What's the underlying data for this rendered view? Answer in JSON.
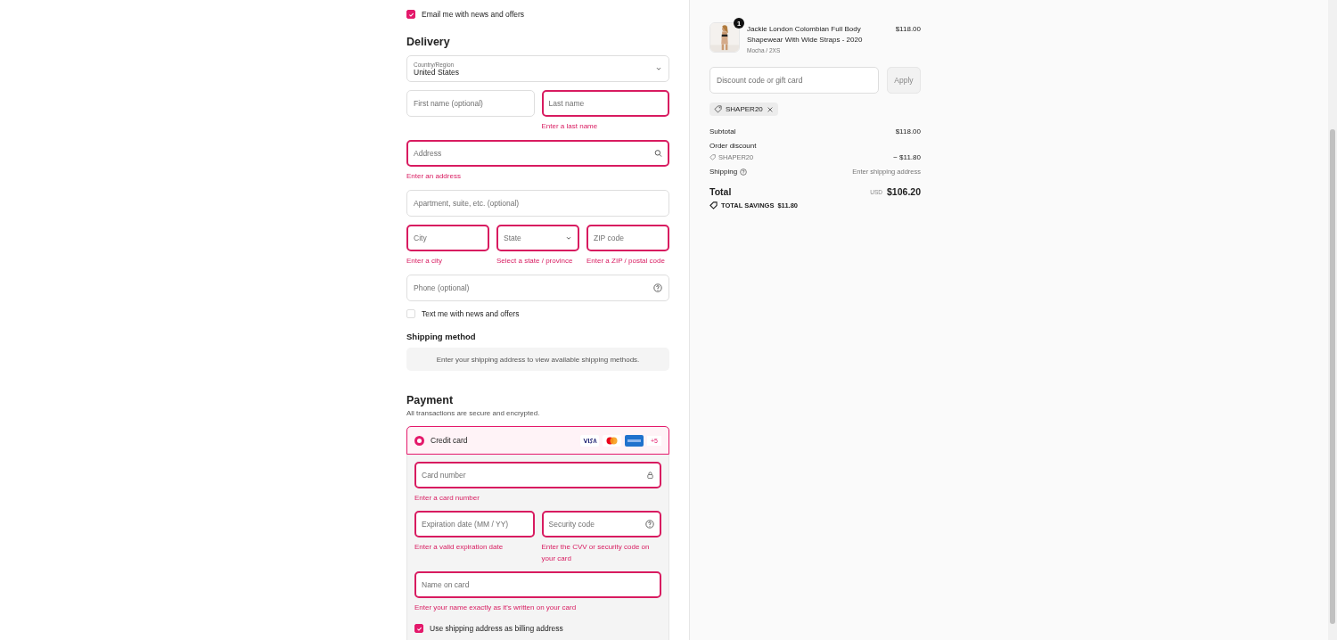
{
  "email_opt_in": {
    "label": "Email me with news and offers",
    "checked": true
  },
  "delivery": {
    "heading": "Delivery",
    "rows": [
      [
        {
          "kind": "select",
          "label": "Country/Region",
          "value": "United States",
          "error": false
        }
      ],
      [
        {
          "kind": "text",
          "placeholder": "First name (optional)",
          "error": false
        },
        {
          "kind": "text",
          "placeholder": "Last name",
          "error": true,
          "message": "Enter a last name"
        }
      ],
      [
        {
          "kind": "search",
          "placeholder": "Address",
          "error": true,
          "message": "Enter an address"
        }
      ],
      [
        {
          "kind": "text",
          "placeholder": "Apartment, suite, etc. (optional)",
          "error": false
        }
      ],
      [
        {
          "kind": "text",
          "placeholder": "City",
          "error": true,
          "message": "Enter a city"
        },
        {
          "kind": "select",
          "placeholder": "State",
          "error": true,
          "message": "Select a state / province"
        },
        {
          "kind": "text",
          "placeholder": "ZIP code",
          "error": true,
          "message": "Enter a ZIP / postal code"
        }
      ],
      [
        {
          "kind": "help",
          "placeholder": "Phone (optional)",
          "error": false
        }
      ]
    ],
    "sms_opt_in": {
      "label": "Text me with news and offers",
      "checked": false
    }
  },
  "shipping_method": {
    "heading": "Shipping method",
    "notice": "Enter your shipping address to view available shipping methods."
  },
  "payment": {
    "heading": "Payment",
    "subtitle": "All transactions are secure and encrypted.",
    "method": {
      "label": "Credit card",
      "selected": true,
      "more_cards": "+5"
    },
    "rows": [
      [
        {
          "kind": "lock",
          "placeholder": "Card number",
          "error": true,
          "message": "Enter a card number"
        }
      ],
      [
        {
          "kind": "text",
          "placeholder": "Expiration date (MM / YY)",
          "error": true,
          "message": "Enter a valid expiration date"
        },
        {
          "kind": "help",
          "placeholder": "Security code",
          "error": true,
          "message": "Enter the CVV or security code on your card"
        }
      ],
      [
        {
          "kind": "text",
          "placeholder": "Name on card",
          "error": true,
          "message": "Enter your name exactly as it's written on your card"
        }
      ]
    ],
    "billing_same": {
      "label": "Use shipping address as billing address",
      "checked": true
    }
  },
  "summary": {
    "product": {
      "quantity": "1",
      "name": "Jackie London Colombian Full Body Shapewear With Wide Straps - 2020",
      "variant": "Mocha / 2XS",
      "price": "$118.00"
    },
    "discount": {
      "placeholder": "Discount code or gift card",
      "button": "Apply",
      "code": "SHAPER20"
    },
    "lines": [
      {
        "kind": "plain",
        "label": "Subtotal",
        "value": "$118.00"
      },
      {
        "kind": "discount",
        "label": "Order discount",
        "code": "SHAPER20",
        "value": "− $11.80"
      },
      {
        "kind": "help",
        "label": "Shipping",
        "value": "Enter shipping address"
      }
    ],
    "total": {
      "label": "Total",
      "currency": "USD",
      "value": "$106.20"
    },
    "savings": {
      "label": "TOTAL SAVINGS",
      "value": "$11.80"
    }
  }
}
